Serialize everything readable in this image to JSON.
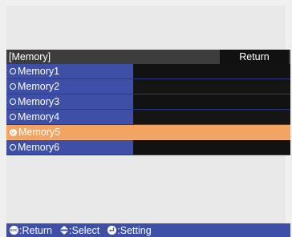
{
  "menu": {
    "title": "[Memory]",
    "return_label": "Return",
    "items": [
      {
        "label": "Memory1",
        "selected": false
      },
      {
        "label": "Memory2",
        "selected": false
      },
      {
        "label": "Memory3",
        "selected": false
      },
      {
        "label": "Memory4",
        "selected": false
      },
      {
        "label": "Memory5",
        "selected": true
      },
      {
        "label": "Memory6",
        "selected": false
      }
    ]
  },
  "status_bar": {
    "return_hint": "Return",
    "select_hint": "Select",
    "setting_hint": "Setting",
    "esc_icon_text": "ESC"
  },
  "colors": {
    "list_blue": "#3d4fa6",
    "selected_orange": "#f4a462",
    "dark": "#121212"
  },
  "icons": [
    "esc-icon",
    "up-down-arrows-icon",
    "enter-icon",
    "radio-icon",
    "radio-checked-icon"
  ]
}
